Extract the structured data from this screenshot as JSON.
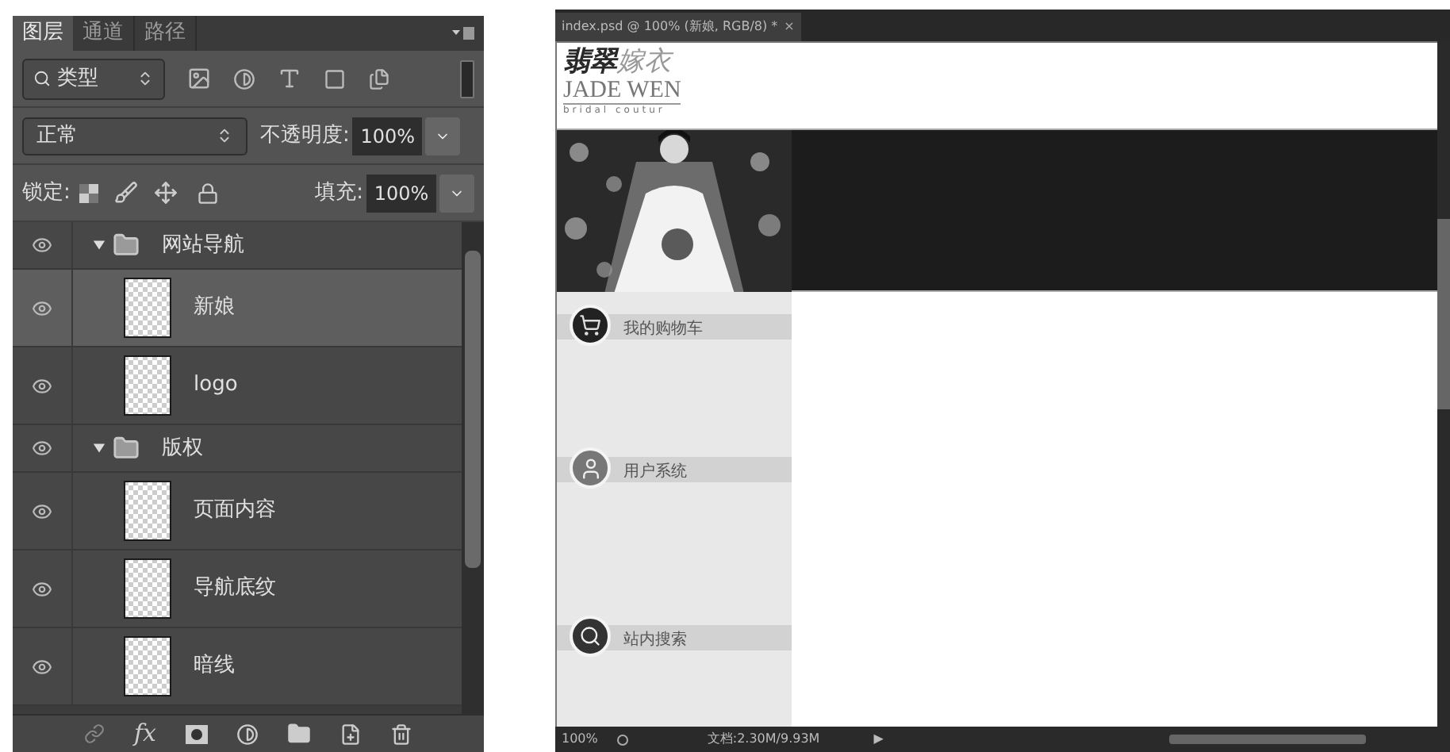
{
  "layers_panel": {
    "tabs": [
      {
        "label": "图层",
        "selected": true
      },
      {
        "label": "通道",
        "selected": false
      },
      {
        "label": "路径",
        "selected": false
      }
    ],
    "filter": {
      "value": "类型"
    },
    "blend_mode": {
      "value": "正常"
    },
    "opacity": {
      "label": "不透明度:",
      "value": "100%"
    },
    "lock": {
      "label": "锁定:"
    },
    "fill": {
      "label": "填充:",
      "value": "100%"
    },
    "layers": [
      {
        "kind": "group",
        "name": "网站导航",
        "visible": true,
        "expanded": true,
        "selected": false,
        "children": [
          {
            "kind": "layer",
            "name": "新娘",
            "visible": true,
            "selected": true
          },
          {
            "kind": "layer",
            "name": "logo",
            "visible": true,
            "selected": false
          }
        ]
      },
      {
        "kind": "group",
        "name": "版权",
        "visible": true,
        "expanded": true,
        "selected": false,
        "children": [
          {
            "kind": "layer",
            "name": "页面内容",
            "visible": true,
            "selected": false
          },
          {
            "kind": "layer",
            "name": "导航底纹",
            "visible": true,
            "selected": false
          },
          {
            "kind": "layer",
            "name": "暗线",
            "visible": true,
            "selected": false
          }
        ]
      }
    ],
    "toolbar": {
      "effects_label": "fx"
    }
  },
  "document": {
    "tab": {
      "title": "index.psd @ 100% (新娘, RGB/8) *",
      "close": "×"
    },
    "logo": {
      "brand_dark": "翡翠",
      "brand_light": "嫁衣",
      "english": "JADE WEN",
      "tagline": "bridal coutur"
    },
    "nav_items": [
      {
        "kind": "cart",
        "label": "我的购物车"
      },
      {
        "kind": "user",
        "label": "用户系统"
      },
      {
        "kind": "search",
        "label": "站内搜索"
      }
    ],
    "status_bar": {
      "zoom": "100%",
      "doc_info": "文档:2.30M/9.93M",
      "arrow": "▶"
    }
  }
}
